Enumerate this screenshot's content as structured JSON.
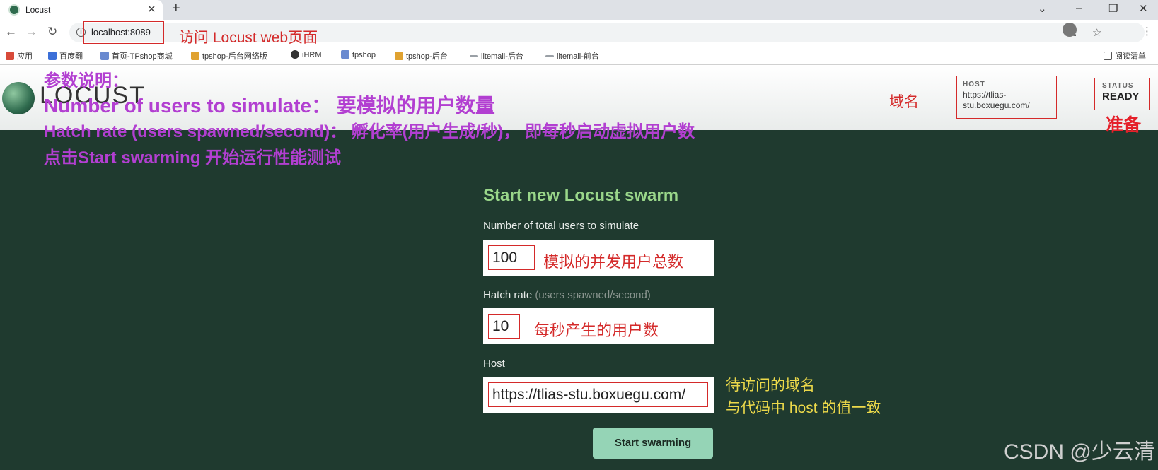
{
  "browser": {
    "tab_title": "Locust",
    "tab_close": "✕",
    "new_tab": "+",
    "url": "localhost:8089",
    "win_controls": [
      "⌄",
      "–",
      "❐",
      "✕"
    ],
    "nav": [
      "←",
      "→",
      "↻"
    ],
    "bookmarks": [
      {
        "label": "应用",
        "color": "#d84a3a"
      },
      {
        "label": "百度翻",
        "color": "#3b6fd8"
      },
      {
        "label": "首页-TPshop商城",
        "color": "#6a8ad0"
      },
      {
        "label": "tpshop-后台网络版",
        "color": "#e0a230"
      },
      {
        "label": "iHRM",
        "color": "#333333"
      },
      {
        "label": "tpshop",
        "color": "#6a8ad0"
      },
      {
        "label": "tpshop-后台",
        "color": "#e0a230"
      },
      {
        "label": "litemall-后台",
        "color": "#9aa0a6"
      },
      {
        "label": "litemall-前台",
        "color": "#9aa0a6"
      }
    ],
    "reading_list": "阅读清单"
  },
  "annotations": {
    "url_note": "访问 Locust web页面",
    "domain_note": "域名",
    "ready_note": "准备",
    "params_title": "参数说明：",
    "param_users": "Number of users to simulate： 要模拟的用户数量",
    "param_hatch": "Hatch rate (users spawned/second)： 孵化率(用户生成/秒)， 即每秒启动虚拟用户数",
    "param_start": "点击Start swarming 开始运行性能测试",
    "users_note": "模拟的并发用户总数",
    "hatch_note": "每秒产生的用户数",
    "host_note_1": "待访问的域名",
    "host_note_2": "与代码中 host 的值一致"
  },
  "locust": {
    "logo_text": "LOCUST",
    "host_label": "HOST",
    "host_value": "https://tlias-stu.boxuegu.com/",
    "status_label": "STATUS",
    "status_value": "READY"
  },
  "form": {
    "title": "Start new Locust swarm",
    "users_label": "Number of total users to simulate",
    "users_value": "100",
    "hatch_label": "Hatch rate",
    "hatch_hint": "(users spawned/second)",
    "hatch_value": "10",
    "host_label": "Host",
    "host_value": "https://tlias-stu.boxuegu.com/",
    "submit_label": "Start swarming"
  },
  "watermark": "CSDN @少云清"
}
